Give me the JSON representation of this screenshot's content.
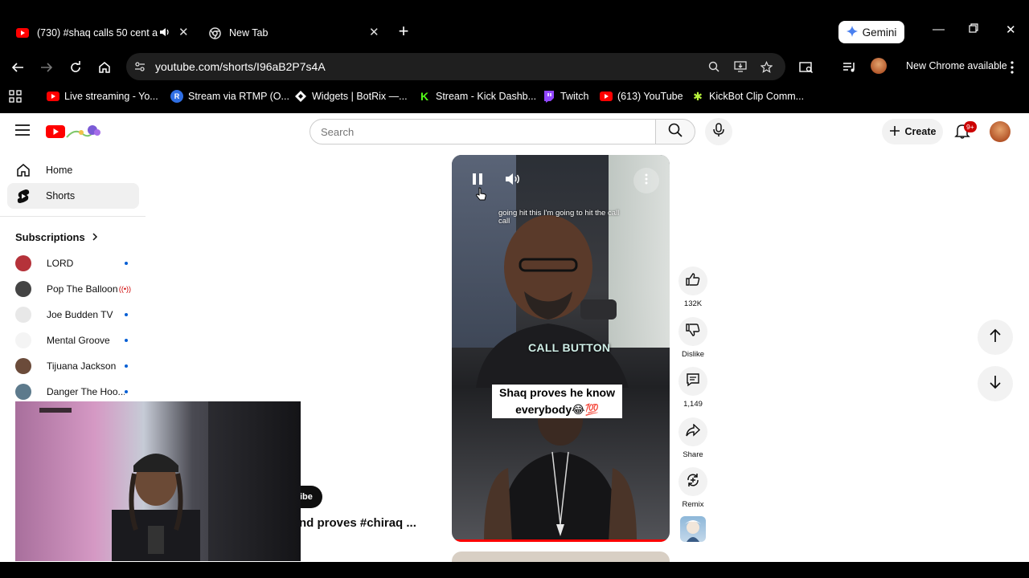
{
  "browser": {
    "tabs": [
      {
        "title": "(730) #shaq calls 50 cent ar",
        "active": true,
        "audio": true
      },
      {
        "title": "New Tab",
        "active": false
      }
    ],
    "gemini_label": "Gemini",
    "url": "youtube.com/shorts/I96aB2P7s4A",
    "update_label": "New Chrome available",
    "bookmarks": [
      {
        "label": "Live streaming - Yo...",
        "icon": "youtube-icon",
        "color": "#ff0000"
      },
      {
        "label": "Stream via RTMP (O...",
        "icon": "restream-icon",
        "color": "#2f6fe4"
      },
      {
        "label": "Widgets | BotRix —...",
        "icon": "botrix-icon",
        "color": "#ffffff"
      },
      {
        "label": "Stream - Kick Dashb...",
        "icon": "kick-icon",
        "color": "#53fc18"
      },
      {
        "label": "Twitch",
        "icon": "twitch-icon",
        "color": "#9146ff"
      },
      {
        "label": "(613) YouTube",
        "icon": "youtube-icon",
        "color": "#ff0000"
      },
      {
        "label": "KickBot Clip Comm...",
        "icon": "kickbot-icon",
        "color": "#b8f23c"
      }
    ]
  },
  "youtube": {
    "search_placeholder": "Search",
    "create_label": "Create",
    "notification_count": "9+",
    "sidebar": {
      "items": [
        {
          "label": "Home",
          "icon": "home-icon",
          "active": false
        },
        {
          "label": "Shorts",
          "icon": "shorts-icon",
          "active": true
        }
      ],
      "subscriptions_title": "Subscriptions",
      "subscriptions": [
        {
          "name": "LORD",
          "status": "dot",
          "color": "#b5323a"
        },
        {
          "name": "Pop The Balloon",
          "status": "live",
          "color": "#444444"
        },
        {
          "name": "Joe Budden TV",
          "status": "dot",
          "color": "#8a8a8a"
        },
        {
          "name": "Mental Groove",
          "status": "dot",
          "color": "#c23c3c"
        },
        {
          "name": "Tijuana Jackson",
          "status": "dot",
          "color": "#6b4b3a"
        },
        {
          "name": "Danger The Hoo...",
          "status": "dot",
          "color": "#5d7a8c"
        }
      ]
    },
    "short": {
      "caption_top": "going hit this I'm going to hit the call call",
      "call_button_text": "CALL BUTTON",
      "caption_main": "Shaq proves he know everybody😂💯",
      "progress": 1.0,
      "subscribe_partial": "ibe",
      "title_partial": "nd proves #chiraq ..."
    },
    "actions": {
      "likes": "132K",
      "dislike_label": "Dislike",
      "comments": "1,149",
      "share_label": "Share",
      "remix_label": "Remix"
    }
  }
}
